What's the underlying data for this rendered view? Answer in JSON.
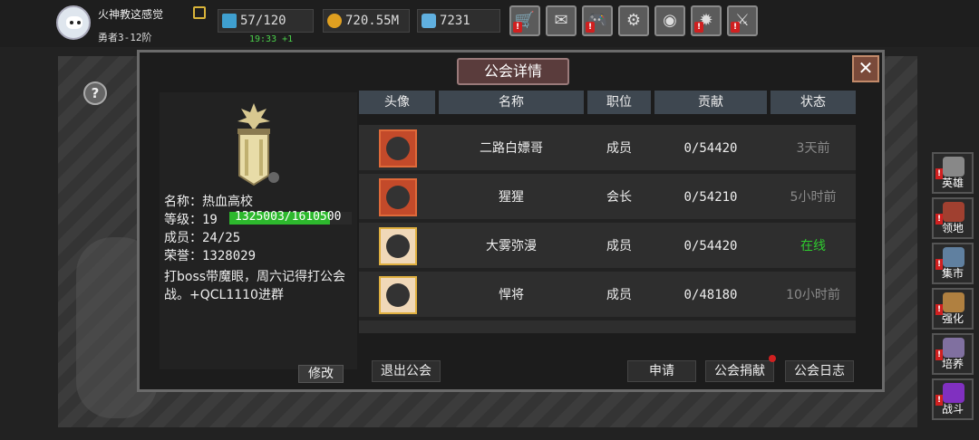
{
  "player": {
    "name": "火神教这感觉",
    "rank": "勇者3-12阶"
  },
  "resources": {
    "stamina": "57/120",
    "stamina_timer": "19:33 +1",
    "gold": "720.55M",
    "gems": "7231"
  },
  "top_buttons": [
    {
      "name": "shop-button",
      "icon": "cart-icon",
      "glyph": "🛒",
      "alert": true
    },
    {
      "name": "mail-button",
      "icon": "mail-icon",
      "glyph": "✉",
      "alert": false
    },
    {
      "name": "gamepad-button",
      "icon": "gamepad-icon",
      "glyph": "🎮",
      "alert": true
    },
    {
      "name": "settings-button",
      "icon": "gear-icon",
      "glyph": "⚙",
      "alert": false
    },
    {
      "name": "color-wheel-button",
      "icon": "color-wheel-icon",
      "glyph": "◉",
      "alert": false
    },
    {
      "name": "event-button",
      "icon": "burst-icon",
      "glyph": "✹",
      "alert": true
    },
    {
      "name": "battle-button",
      "icon": "crossed-swords-icon",
      "glyph": "⚔",
      "alert": true
    }
  ],
  "dialog": {
    "title": "公会详情",
    "close": "✕"
  },
  "guild": {
    "name_label": "名称：",
    "name": "热血高校",
    "level_label": "等级：",
    "level": "19",
    "exp_text": "1325003/1610500",
    "exp_progress": 0.82,
    "members_label": "成员：",
    "members": "24/25",
    "honor_label": "荣誉：",
    "honor": "1328029",
    "notice": "打boss带魔眼，周六记得打公会战。+QCL1110进群",
    "edit_label": "修改"
  },
  "table": {
    "headers": [
      "头像",
      "名称",
      "职位",
      "贡献",
      "状态"
    ],
    "rows": [
      {
        "name": "二路白嫖哥",
        "role": "成员",
        "contribution": "0/54420",
        "status": "3天前",
        "online": false,
        "avatar_style": "red"
      },
      {
        "name": "猩猩",
        "role": "会长",
        "contribution": "0/54210",
        "status": "5小时前",
        "online": false,
        "avatar_style": "red"
      },
      {
        "name": "大雾弥漫",
        "role": "成员",
        "contribution": "0/54420",
        "status": "在线",
        "online": true,
        "avatar_style": "gold"
      },
      {
        "name": "悍将",
        "role": "成员",
        "contribution": "0/48180",
        "status": "10小时前",
        "online": false,
        "avatar_style": "gold"
      }
    ]
  },
  "actions": {
    "leave": "退出公会",
    "apply": "申请",
    "donate": "公会捐献",
    "log": "公会日志"
  },
  "side_menu": [
    {
      "name": "side-hero",
      "label": "英雄",
      "icon": "helmet-icon",
      "color": "#888",
      "alert": true
    },
    {
      "name": "side-territory",
      "label": "领地",
      "icon": "castle-icon",
      "color": "#a04030",
      "alert": true
    },
    {
      "name": "side-market",
      "label": "集市",
      "icon": "market-icon",
      "color": "#6080a0",
      "alert": true
    },
    {
      "name": "side-enhance",
      "label": "强化",
      "icon": "gem-icon",
      "color": "#b08040",
      "alert": true
    },
    {
      "name": "side-train",
      "label": "培养",
      "icon": "cup-icon",
      "color": "#8070a0",
      "alert": true
    },
    {
      "name": "side-fight",
      "label": "战斗",
      "icon": "portal-icon",
      "color": "#8030c0",
      "alert": true
    }
  ],
  "colors": {
    "online": "#2ecc2e",
    "offline": "#8a8a8a",
    "accent_red": "#d02020",
    "exp_bar": "#2db82d"
  }
}
